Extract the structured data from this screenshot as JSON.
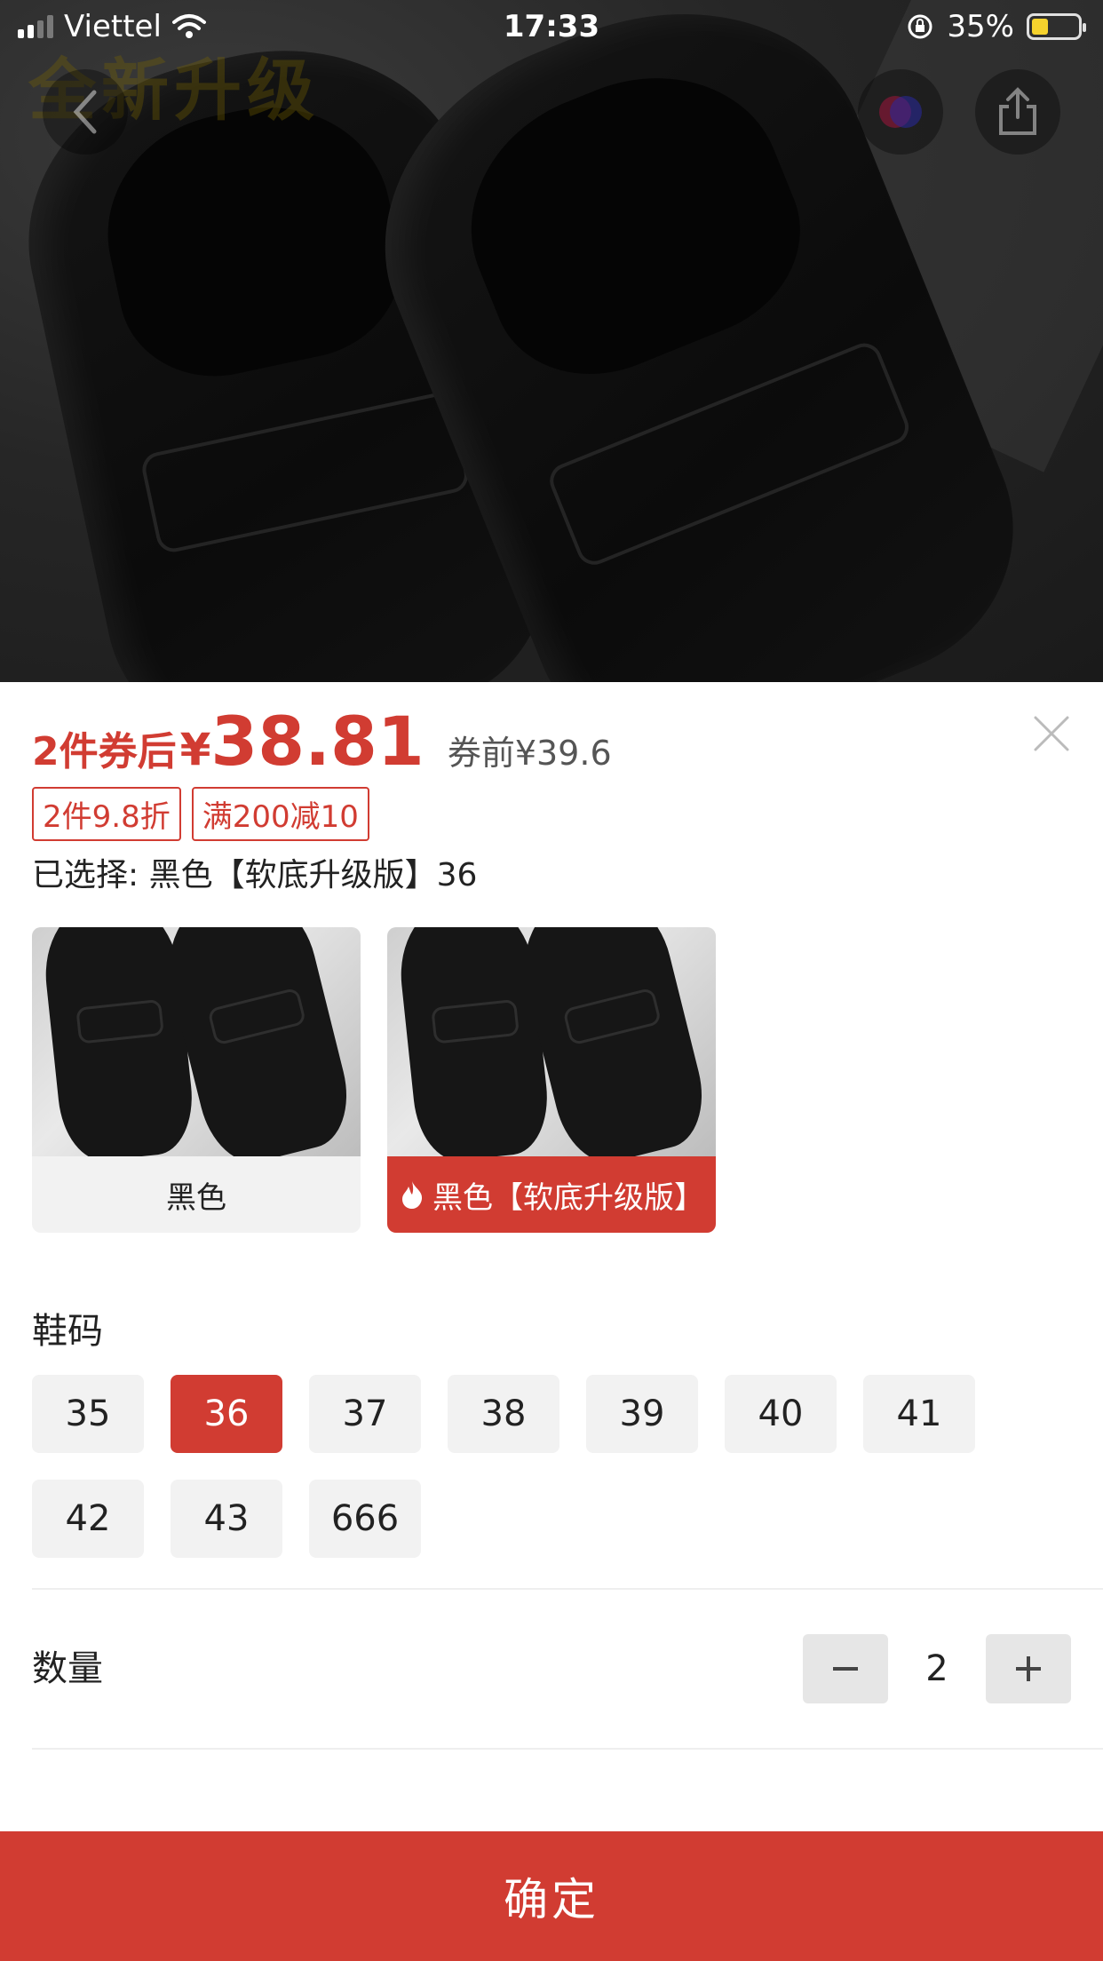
{
  "status_bar": {
    "carrier": "Viettel",
    "time": "17:33",
    "battery_percent_text": "35%",
    "battery_level": 0.35
  },
  "hero": {
    "overlay_text": "全新升级"
  },
  "price": {
    "prefix": "2件券后",
    "currency": "¥",
    "value": "38.81",
    "before": "券前¥39.6"
  },
  "tags": [
    "2件9.8折",
    "满200减10"
  ],
  "selected_text": "已选择: 黑色【软底升级版】36",
  "variants": [
    {
      "label": "黑色",
      "active": false
    },
    {
      "label": "黑色【软底升级版】",
      "active": true,
      "icon": "flame-icon"
    }
  ],
  "size_section": {
    "title": "鞋码",
    "options": [
      "35",
      "36",
      "37",
      "38",
      "39",
      "40",
      "41",
      "42",
      "43",
      "666"
    ],
    "selected": "36"
  },
  "quantity": {
    "title": "数量",
    "value": "2",
    "minus_label": "−",
    "plus_label": "+"
  },
  "confirm_label": "确定",
  "colors": {
    "accent": "#d13c32",
    "chip_bg": "#f2f2f2"
  }
}
